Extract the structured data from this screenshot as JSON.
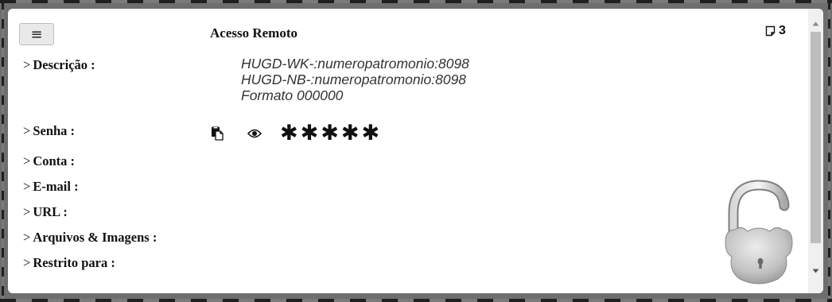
{
  "header": {
    "menu_icon": "hamburger-icon",
    "menu_glyph": "≡",
    "title": "Acesso Remoto",
    "notes_icon": "note-icon",
    "notes_count": "3"
  },
  "fields": {
    "chevron": ">",
    "descricao": "Descrição :",
    "senha": "Senha :",
    "conta": "Conta :",
    "email": "E-mail :",
    "url": "URL :",
    "arquivos": "Arquivos & Imagens :",
    "restrito": "Restrito para :"
  },
  "description": {
    "lines": [
      "HUGD-WK-:numeropatromonio:8098",
      "HUGD-NB-:numeropatromonio:8098",
      "Formato 000000"
    ]
  },
  "password": {
    "copy_icon": "copy-icon",
    "reveal_icon": "eye-icon",
    "masked": "✱✱✱✱✱"
  },
  "decoration": {
    "lock_icon": "open-padlock-icon"
  },
  "scrollbar": {
    "up_icon": "scroll-up-arrow-icon",
    "down_icon": "scroll-down-arrow-icon"
  }
}
